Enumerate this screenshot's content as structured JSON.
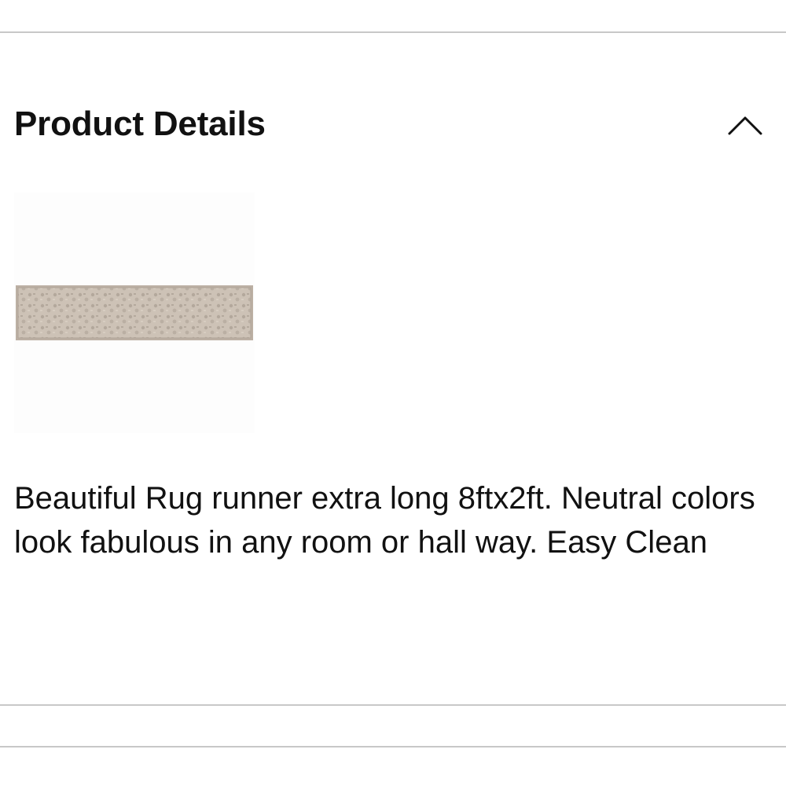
{
  "section": {
    "title": "Product Details",
    "toggle_icon": "chevron-up-icon",
    "expanded": true
  },
  "product": {
    "image_alt": "Rug runner",
    "image_colors": {
      "base": "#cfc4b8",
      "pattern": "#a89c90",
      "border": "#b8aca0"
    },
    "description": "Beautiful Rug runner extra long 8ftx2ft. Neutral colors look fabulous in any room or hall way. Easy Clean"
  }
}
